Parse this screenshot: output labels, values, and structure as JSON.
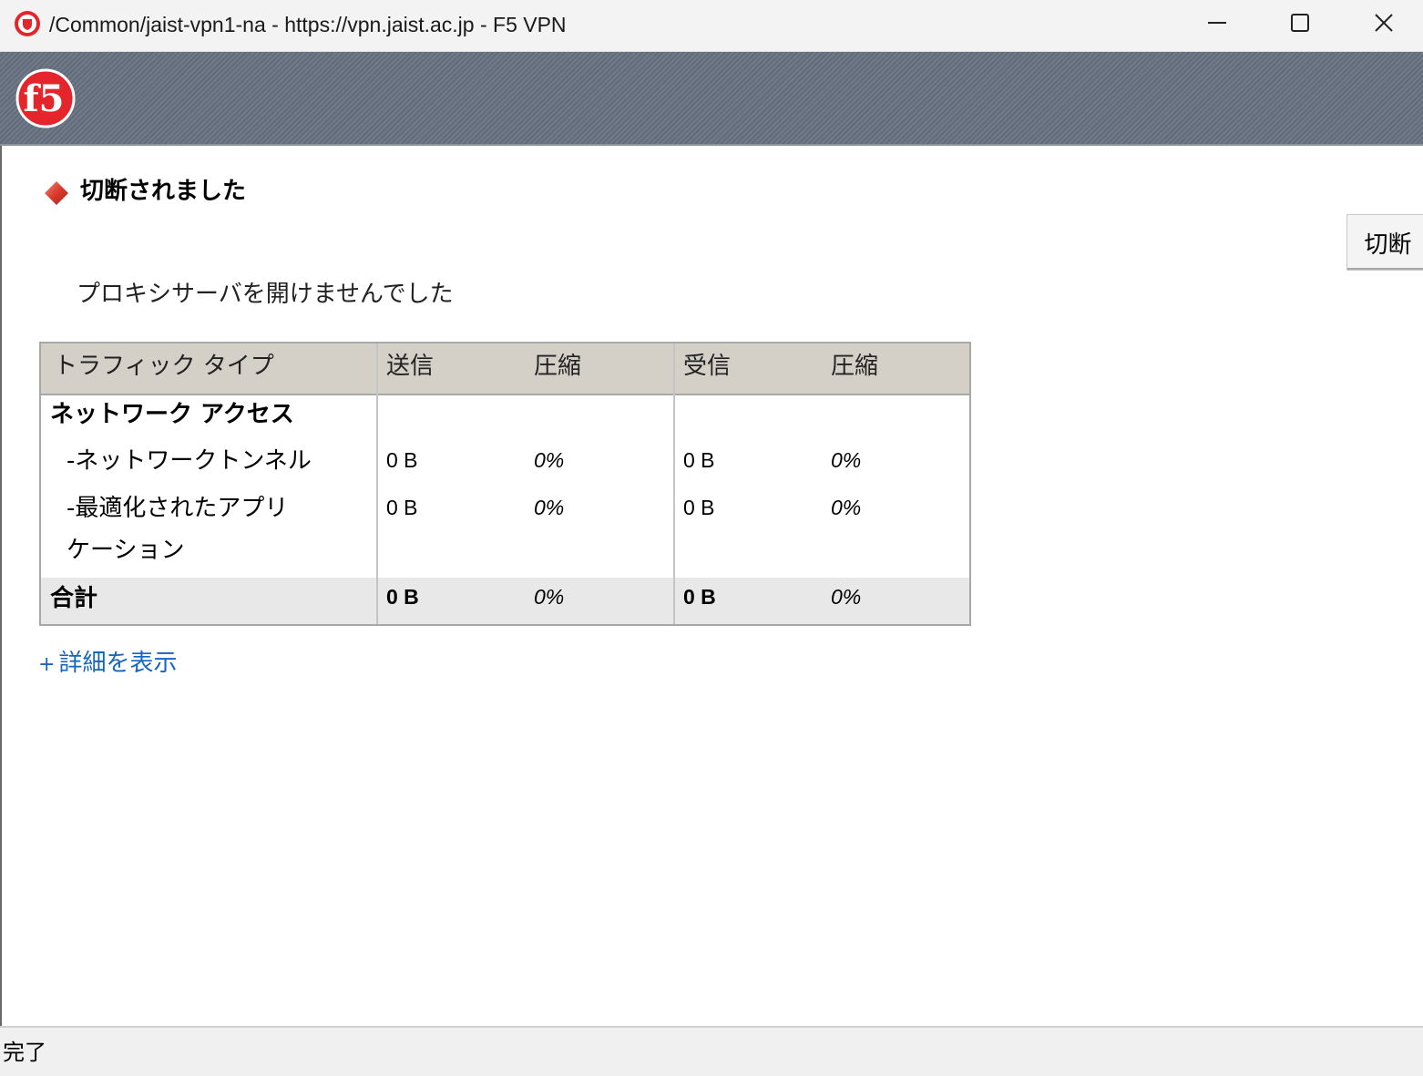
{
  "window": {
    "title": "/Common/jaist-vpn1-na - https://vpn.jaist.ac.jp - F5 VPN",
    "controls": [
      "minimize-icon",
      "maximize-icon",
      "close-icon"
    ]
  },
  "banner": {
    "logo_text": "f5",
    "logo_color": "#e4262c"
  },
  "status": {
    "text": "切断されました",
    "icon": "red-diamond-icon",
    "color": "#d93a2b"
  },
  "disconnect_button": {
    "label": "切断"
  },
  "message": "プロキシサーバを開けませんでした",
  "table": {
    "headers": [
      "トラフィック タイプ",
      "送信",
      "圧縮",
      "受信",
      "圧縮"
    ],
    "section_title": "ネットワーク アクセス",
    "rows": [
      {
        "type": "-ネットワークトンネル",
        "sent": "0 B",
        "sent_compression": "0%",
        "received": "0 B",
        "received_compression": "0%"
      },
      {
        "type_line1": "-最適化されたアプリ",
        "type_line2": "ケーション",
        "sent": "0 B",
        "sent_compression": "0%",
        "received": "0 B",
        "received_compression": "0%"
      }
    ],
    "total": {
      "label": "合計",
      "sent": "0 B",
      "sent_compression": "0%",
      "received": "0 B",
      "received_compression": "0%"
    }
  },
  "details_link": {
    "prefix": "+",
    "label": "詳細を表示",
    "color": "#1565c0"
  },
  "statusbar": {
    "text": "完了"
  }
}
